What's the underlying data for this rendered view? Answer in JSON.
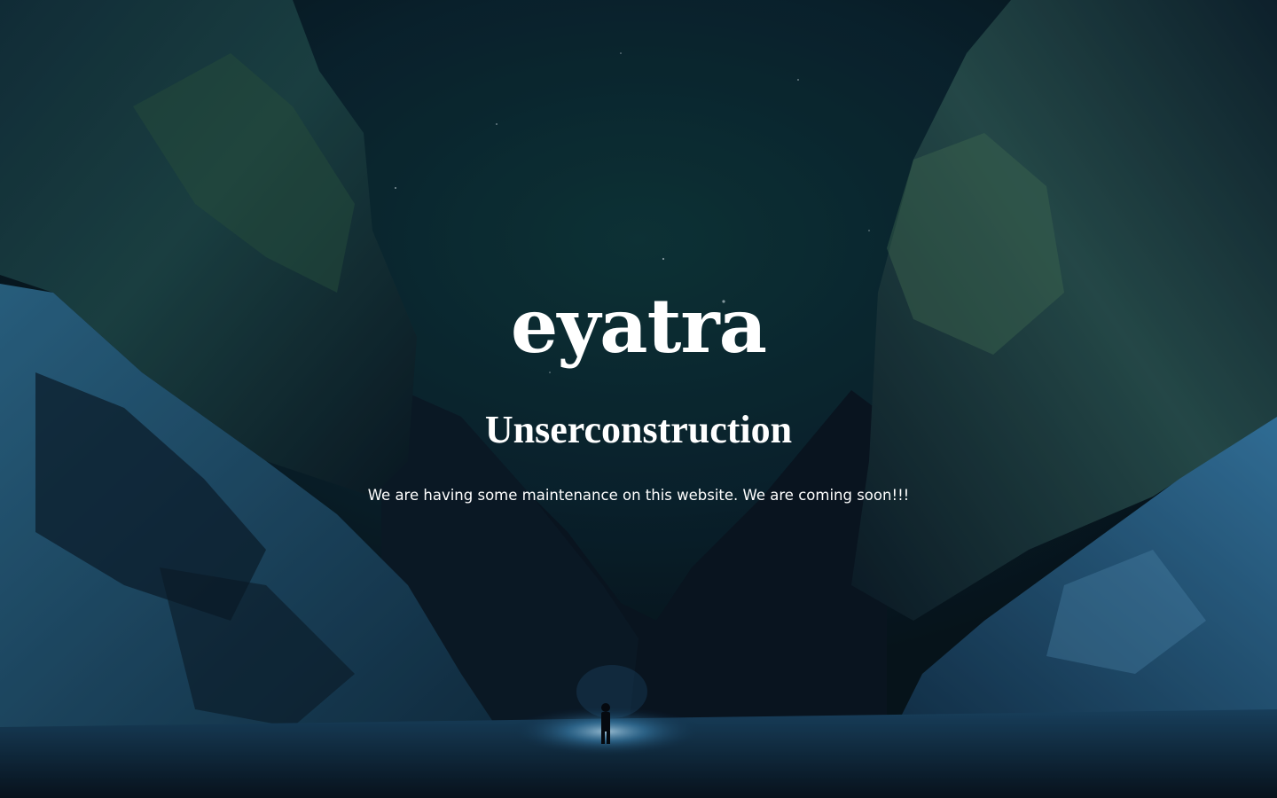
{
  "site": {
    "logo": "eyatra"
  },
  "maintenance": {
    "headline": "Unserconstruction",
    "message": "We are having some maintenance on this website. We are coming soon!!!"
  },
  "background": {
    "image_icon": "night-canyon-photo"
  },
  "colors": {
    "text": "#ffffff",
    "sky": "#0d2a30",
    "rock": "#0b1d26",
    "snow": "#3f7fa8"
  }
}
